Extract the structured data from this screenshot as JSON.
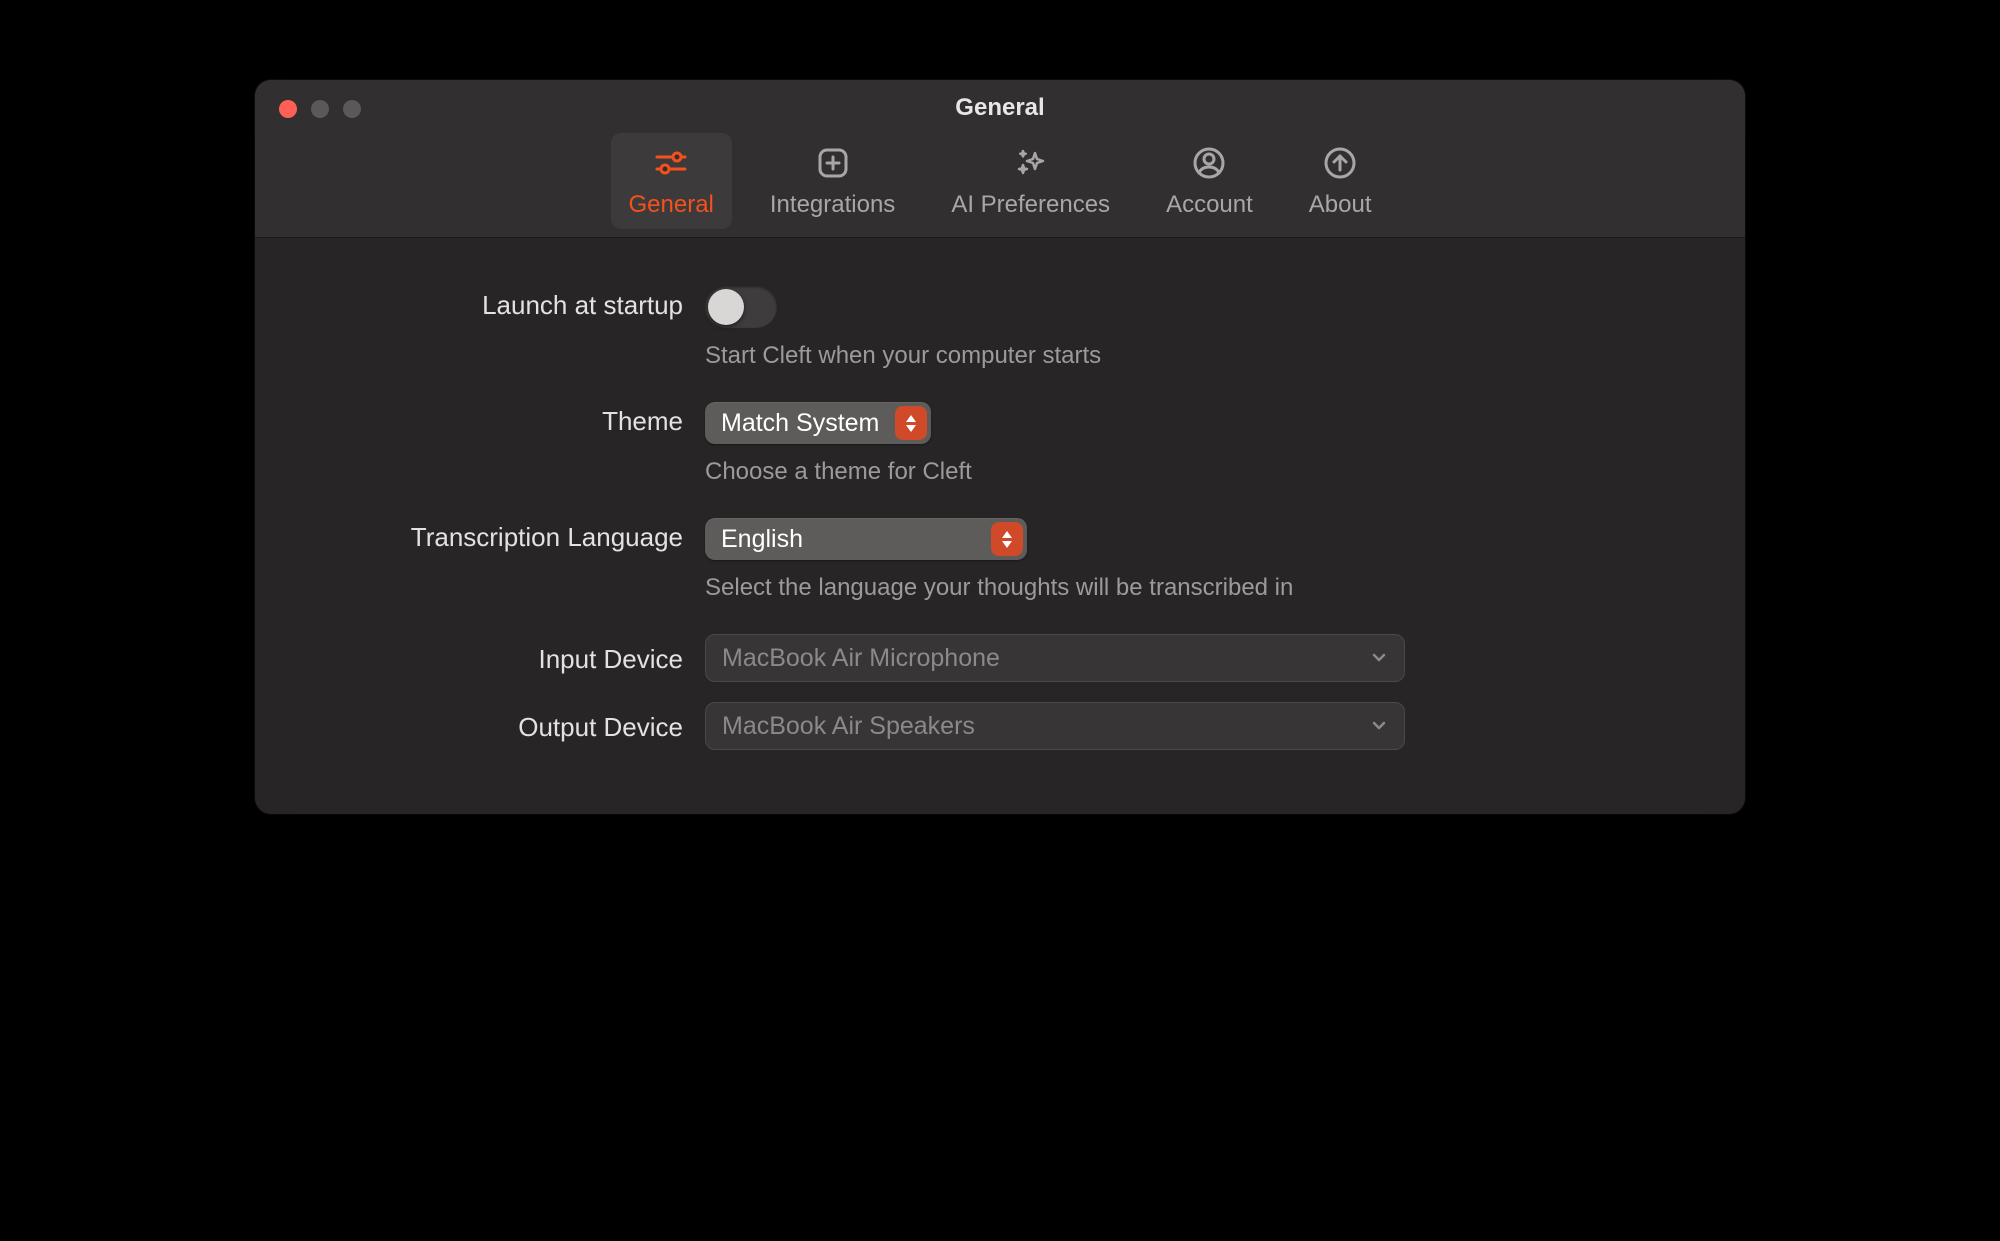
{
  "window": {
    "title": "General"
  },
  "toolbar": {
    "general": "General",
    "integrations": "Integrations",
    "ai_preferences": "AI Preferences",
    "account": "Account",
    "about": "About"
  },
  "settings": {
    "launch_at_startup": {
      "label": "Launch at startup",
      "enabled": false,
      "description": "Start Cleft when your computer starts"
    },
    "theme": {
      "label": "Theme",
      "value": "Match System",
      "description": "Choose a theme for Cleft"
    },
    "transcription_language": {
      "label": "Transcription Language",
      "value": "English",
      "description": "Select the language your thoughts will be transcribed in"
    },
    "input_device": {
      "label": "Input Device",
      "value": "MacBook Air Microphone"
    },
    "output_device": {
      "label": "Output Device",
      "value": "MacBook Air Speakers"
    }
  },
  "colors": {
    "accent": "#f4511e"
  }
}
